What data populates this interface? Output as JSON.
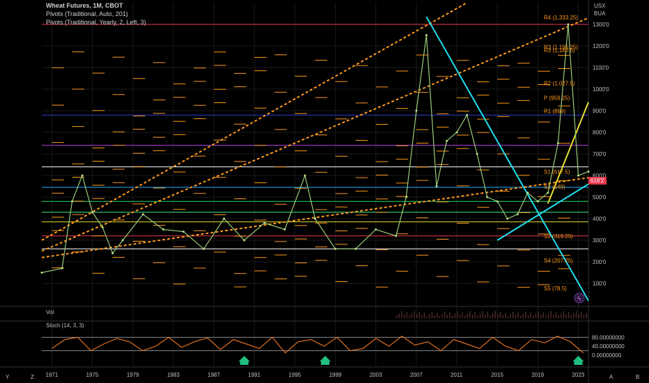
{
  "header": {
    "title": "Wheat Futures, 1M, CBOT",
    "indicator_1": "Pivots (Traditional, Auto, 201)",
    "indicator_2": "Pivots (Traditional, Yearly, 2, Left, 3)"
  },
  "price_axis": {
    "currency": "USX",
    "exchange_hint": "BUA",
    "ticks": [
      "1300'0",
      "1200'0",
      "1100'0",
      "1000'0",
      "900'0",
      "800'0",
      "700'0",
      "600'0",
      "500'0",
      "400'0",
      "300'0",
      "200'0",
      "100'0"
    ],
    "current_price_tag": "618'2"
  },
  "volume_label": "Vol",
  "stochastic": {
    "label": "Stoch (14, 3, 3)",
    "ticks": [
      "80.00000000",
      "40.00000000",
      "0.00000000"
    ],
    "buy_signal_years": [
      1990,
      1998,
      2023
    ]
  },
  "time_axis": {
    "ticks": [
      "1971",
      "1975",
      "1979",
      "1983",
      "1987",
      "1991",
      "1995",
      "1999",
      "2003",
      "2007",
      "2011",
      "2015",
      "2019",
      "2023"
    ]
  },
  "bottom_controls": {
    "left": [
      "Y",
      "Z"
    ],
    "right": [
      "A",
      "B"
    ]
  },
  "pivot_annotations": [
    "R4 (1,333.25)",
    "R3 (1,195.25)",
    "R3 (1,180.5)",
    "R2 (1,027.5)",
    "P (959.25)",
    "R1 (899)",
    "S1 (617.5)",
    "S2 (549)",
    "S3 (319.25)",
    "S4 (207.25)",
    "S5 (78.5)"
  ],
  "chart_data": {
    "type": "line",
    "title": "Wheat Futures, 1M, CBOT",
    "x_range": [
      1970,
      2024
    ],
    "y_range": [
      0,
      1400
    ],
    "series": [
      {
        "name": "Wheat Futures",
        "x": [
          1970,
          1972,
          1973,
          1974,
          1975,
          1976,
          1977,
          1978,
          1980,
          1982,
          1984,
          1986,
          1988,
          1990,
          1992,
          1994,
          1996,
          1997,
          1999,
          2001,
          2003,
          2005,
          2006,
          2007,
          2008,
          2009,
          2010,
          2011,
          2012,
          2013,
          2014,
          2015,
          2016,
          2017,
          2018,
          2019,
          2020,
          2021,
          2022,
          2023,
          2024
        ],
        "y": [
          150,
          170,
          480,
          600,
          430,
          360,
          240,
          300,
          420,
          350,
          340,
          260,
          400,
          300,
          380,
          350,
          600,
          400,
          260,
          260,
          350,
          320,
          500,
          900,
          1250,
          550,
          760,
          800,
          880,
          700,
          500,
          480,
          400,
          420,
          520,
          480,
          520,
          750,
          1300,
          600,
          618
        ]
      }
    ],
    "horizontal_levels": [
      1300,
      880,
      740,
      640,
      545,
      480,
      430,
      385,
      320,
      260
    ],
    "stochastic_series": [
      30,
      70,
      80,
      20,
      50,
      75,
      60,
      20,
      40,
      80,
      35,
      60,
      78,
      25,
      70,
      50,
      30,
      80,
      10,
      60,
      70,
      40,
      80,
      20,
      30,
      75,
      40,
      85,
      45,
      60,
      20,
      70,
      50,
      30,
      80,
      40,
      20,
      70,
      55,
      85,
      60,
      10
    ],
    "stochastic_ylim": [
      0,
      100
    ]
  }
}
